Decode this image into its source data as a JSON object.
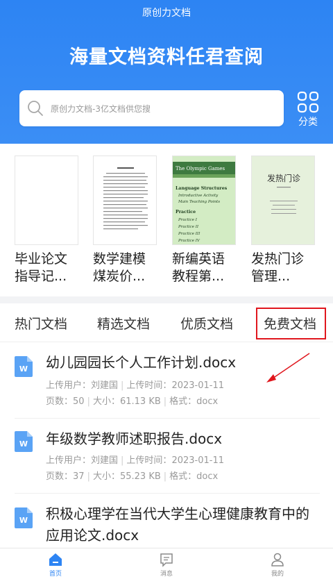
{
  "header": {
    "app_title": "原创力文档",
    "slogan": "海量文档资料任君查阅",
    "search_placeholder": "原创力文档-3亿文档供您搜",
    "category_label": "分类"
  },
  "books": [
    {
      "title": "毕业论文指导记...",
      "cover_icon": "thesis-cover"
    },
    {
      "title": "数学建模煤炭价...",
      "cover_icon": "math-paper-cover"
    },
    {
      "title": "新编英语教程第...",
      "cover_icon": "english-textbook-cover",
      "cover_text": {
        "banner": "The Olympic Games",
        "section1": "Language Structures",
        "line1": "Introductive Activity",
        "line2": "Main Teaching Points",
        "section2": "Practice",
        "p1": "Practice I",
        "p2": "Practice II",
        "p3": "Practice III",
        "p4": "Practice IV"
      }
    },
    {
      "title": "发热门诊管理...",
      "cover_icon": "clinic-doc-cover",
      "cover_text": "发热门诊"
    }
  ],
  "tabs": [
    "热门文档",
    "精选文档",
    "优质文档",
    "免费文档"
  ],
  "docs": [
    {
      "title": "幼儿园园长个人工作计划.docx",
      "uploader_label": "上传用户：",
      "uploader": "刘建国",
      "time_label": "上传时间：",
      "time": "2023-01-11",
      "pages_label": "页数：",
      "pages": "50",
      "size_label": "大小：",
      "size": "61.13 KB",
      "format_label": "格式：",
      "format": "docx"
    },
    {
      "title": "年级数学教师述职报告.docx",
      "uploader_label": "上传用户：",
      "uploader": "刘建国",
      "time_label": "上传时间：",
      "time": "2023-01-11",
      "pages_label": "页数：",
      "pages": "37",
      "size_label": "大小：",
      "size": "55.23 KB",
      "format_label": "格式：",
      "format": "docx"
    },
    {
      "title": "积极心理学在当代大学生心理健康教育中的应用论文.docx"
    }
  ],
  "bottom_nav": [
    {
      "label": "首页",
      "icon": "home-icon",
      "active": true
    },
    {
      "label": "消息",
      "icon": "message-icon",
      "active": false
    },
    {
      "label": "我的",
      "icon": "profile-icon",
      "active": false
    }
  ],
  "colors": {
    "brand": "#2d84f3",
    "highlight": "#e0161d",
    "doc_icon": "#4a9af5"
  }
}
